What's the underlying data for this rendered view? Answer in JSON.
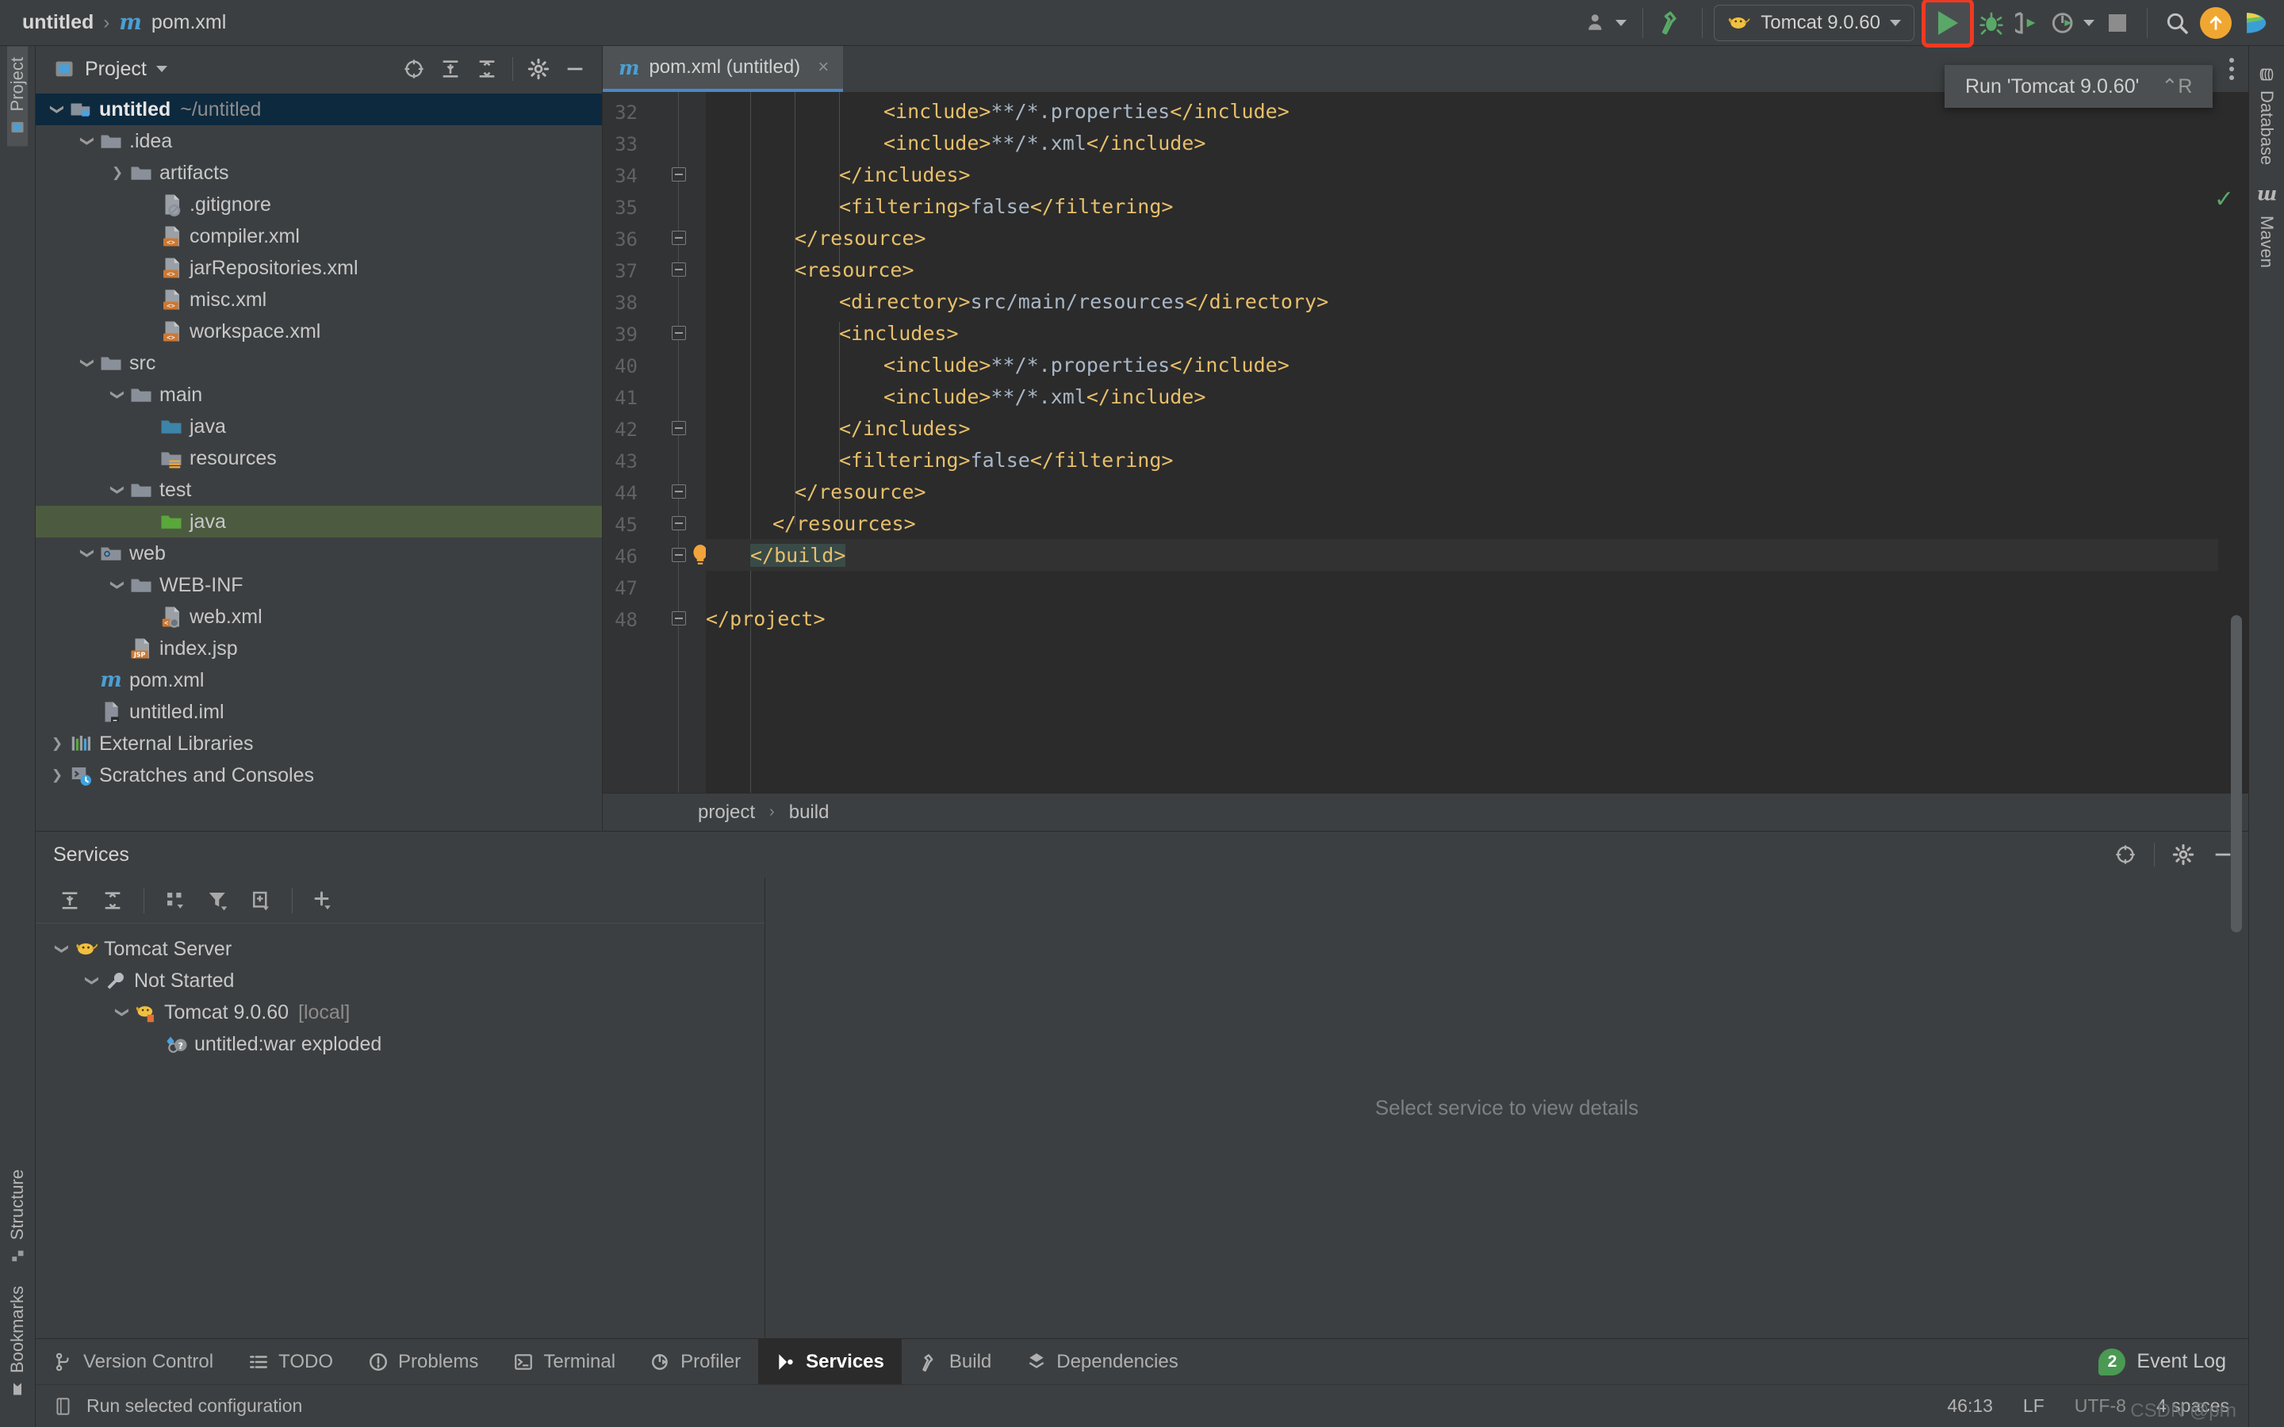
{
  "titlebar": {
    "project_name": "untitled",
    "separator": "›",
    "file_icon": "maven-icon",
    "file_name": "pom.xml",
    "account_icon": "account-icon",
    "build_icon": "build-hammer-icon",
    "run_config_icon": "tomcat-icon",
    "run_config_label": "Tomcat 9.0.60",
    "run_icon": "run-icon",
    "debug_icon": "debug-icon",
    "run_coverage_icon": "run-with-coverage-icon",
    "profiler_icon": "profiler-icon",
    "stop_icon": "stop-icon",
    "search_icon": "search-everywhere-icon",
    "update_icon": "update-project-icon",
    "ide_icon": "ide-feature-icon"
  },
  "tooltip": {
    "label": "Run 'Tomcat 9.0.60'",
    "shortcut": "⌃R"
  },
  "left_stripe": {
    "items": [
      {
        "label": "Project",
        "icon": "project-folder-icon",
        "active": true
      },
      {
        "label": "Structure",
        "icon": "structure-icon",
        "active": false
      },
      {
        "label": "Bookmarks",
        "icon": "bookmark-icon",
        "active": false
      }
    ]
  },
  "right_stripe": {
    "items": [
      {
        "label": "Database",
        "icon": "database-icon"
      },
      {
        "label": "Maven",
        "icon": "maven-icon"
      }
    ]
  },
  "project_panel": {
    "title": "Project",
    "caret": "▾",
    "icons": [
      "locate-icon",
      "expand-all-icon",
      "collapse-all-icon",
      "settings-gear-icon",
      "hide-icon"
    ],
    "tree": [
      {
        "depth": 0,
        "arrow": "down",
        "icon": "module-icon",
        "label": "untitled",
        "suffix": "~/untitled",
        "bold": true,
        "state": "selected-blue"
      },
      {
        "depth": 1,
        "arrow": "down",
        "icon": "folder-icon",
        "label": ".idea",
        "suffix": "",
        "bold": false,
        "state": ""
      },
      {
        "depth": 2,
        "arrow": "right",
        "icon": "folder-icon",
        "label": "artifacts",
        "suffix": "",
        "bold": false,
        "state": ""
      },
      {
        "depth": 3,
        "arrow": "none",
        "icon": "gitignore-file-icon",
        "label": ".gitignore",
        "suffix": "",
        "bold": false,
        "state": ""
      },
      {
        "depth": 3,
        "arrow": "none",
        "icon": "xml-file-icon",
        "label": "compiler.xml",
        "suffix": "",
        "bold": false,
        "state": ""
      },
      {
        "depth": 3,
        "arrow": "none",
        "icon": "xml-file-icon",
        "label": "jarRepositories.xml",
        "suffix": "",
        "bold": false,
        "state": ""
      },
      {
        "depth": 3,
        "arrow": "none",
        "icon": "xml-file-icon",
        "label": "misc.xml",
        "suffix": "",
        "bold": false,
        "state": ""
      },
      {
        "depth": 3,
        "arrow": "none",
        "icon": "xml-file-icon",
        "label": "workspace.xml",
        "suffix": "",
        "bold": false,
        "state": ""
      },
      {
        "depth": 1,
        "arrow": "down",
        "icon": "folder-icon",
        "label": "src",
        "suffix": "",
        "bold": false,
        "state": ""
      },
      {
        "depth": 2,
        "arrow": "down",
        "icon": "folder-icon",
        "label": "main",
        "suffix": "",
        "bold": false,
        "state": ""
      },
      {
        "depth": 3,
        "arrow": "none",
        "icon": "source-root-icon",
        "label": "java",
        "suffix": "",
        "bold": false,
        "state": ""
      },
      {
        "depth": 3,
        "arrow": "none",
        "icon": "resource-root-icon",
        "label": "resources",
        "suffix": "",
        "bold": false,
        "state": ""
      },
      {
        "depth": 2,
        "arrow": "down",
        "icon": "folder-icon",
        "label": "test",
        "suffix": "",
        "bold": false,
        "state": ""
      },
      {
        "depth": 3,
        "arrow": "none",
        "icon": "test-root-icon",
        "label": "java",
        "suffix": "",
        "bold": false,
        "state": "selected-green"
      },
      {
        "depth": 1,
        "arrow": "down",
        "icon": "web-folder-icon",
        "label": "web",
        "suffix": "",
        "bold": false,
        "state": ""
      },
      {
        "depth": 2,
        "arrow": "down",
        "icon": "folder-icon",
        "label": "WEB-INF",
        "suffix": "",
        "bold": false,
        "state": ""
      },
      {
        "depth": 3,
        "arrow": "none",
        "icon": "web-xml-file-icon",
        "label": "web.xml",
        "suffix": "",
        "bold": false,
        "state": ""
      },
      {
        "depth": 2,
        "arrow": "none",
        "icon": "jsp-file-icon",
        "label": "index.jsp",
        "suffix": "",
        "bold": false,
        "state": ""
      },
      {
        "depth": 1,
        "arrow": "none",
        "icon": "maven-icon",
        "label": "pom.xml",
        "suffix": "",
        "bold": false,
        "state": ""
      },
      {
        "depth": 1,
        "arrow": "none",
        "icon": "iml-file-icon",
        "label": "untitled.iml",
        "suffix": "",
        "bold": false,
        "state": ""
      },
      {
        "depth": 0,
        "arrow": "right",
        "icon": "libraries-icon",
        "label": "External Libraries",
        "suffix": "",
        "bold": false,
        "state": ""
      },
      {
        "depth": 0,
        "arrow": "right",
        "icon": "scratches-icon",
        "label": "Scratches and Consoles",
        "suffix": "",
        "bold": false,
        "state": ""
      }
    ]
  },
  "editor": {
    "tab": {
      "icon": "maven-icon",
      "label": "pom.xml (untitled)",
      "close": "×"
    },
    "options_icon": "editor-options-icon",
    "first_line": 32,
    "lines": [
      {
        "n": 32,
        "indent": 16,
        "fold": false,
        "bulb": false,
        "parts": [
          {
            "t": "tag",
            "v": "<include>"
          },
          {
            "t": "txt",
            "v": "**/*.properties"
          },
          {
            "t": "tag",
            "v": "</include>"
          }
        ]
      },
      {
        "n": 33,
        "indent": 16,
        "fold": false,
        "bulb": false,
        "parts": [
          {
            "t": "tag",
            "v": "<include>"
          },
          {
            "t": "txt",
            "v": "**/*.xml"
          },
          {
            "t": "tag",
            "v": "</include>"
          }
        ]
      },
      {
        "n": 34,
        "indent": 12,
        "fold": true,
        "bulb": false,
        "parts": [
          {
            "t": "tag",
            "v": "</includes>"
          }
        ]
      },
      {
        "n": 35,
        "indent": 12,
        "fold": false,
        "bulb": false,
        "parts": [
          {
            "t": "tag",
            "v": "<filtering>"
          },
          {
            "t": "txt",
            "v": "false"
          },
          {
            "t": "tag",
            "v": "</filtering>"
          }
        ]
      },
      {
        "n": 36,
        "indent": 8,
        "fold": true,
        "bulb": false,
        "parts": [
          {
            "t": "tag",
            "v": "</resource>"
          }
        ]
      },
      {
        "n": 37,
        "indent": 8,
        "fold": true,
        "bulb": false,
        "parts": [
          {
            "t": "tag",
            "v": "<resource>"
          }
        ]
      },
      {
        "n": 38,
        "indent": 12,
        "fold": false,
        "bulb": false,
        "parts": [
          {
            "t": "tag",
            "v": "<directory>"
          },
          {
            "t": "txt",
            "v": "src/main/resources"
          },
          {
            "t": "tag",
            "v": "</directory>"
          }
        ]
      },
      {
        "n": 39,
        "indent": 12,
        "fold": true,
        "bulb": false,
        "parts": [
          {
            "t": "tag",
            "v": "<includes>"
          }
        ]
      },
      {
        "n": 40,
        "indent": 16,
        "fold": false,
        "bulb": false,
        "parts": [
          {
            "t": "tag",
            "v": "<include>"
          },
          {
            "t": "txt",
            "v": "**/*.properties"
          },
          {
            "t": "tag",
            "v": "</include>"
          }
        ]
      },
      {
        "n": 41,
        "indent": 16,
        "fold": false,
        "bulb": false,
        "parts": [
          {
            "t": "tag",
            "v": "<include>"
          },
          {
            "t": "txt",
            "v": "**/*.xml"
          },
          {
            "t": "tag",
            "v": "</include>"
          }
        ]
      },
      {
        "n": 42,
        "indent": 12,
        "fold": true,
        "bulb": false,
        "parts": [
          {
            "t": "tag",
            "v": "</includes>"
          }
        ]
      },
      {
        "n": 43,
        "indent": 12,
        "fold": false,
        "bulb": false,
        "parts": [
          {
            "t": "tag",
            "v": "<filtering>"
          },
          {
            "t": "txt",
            "v": "false"
          },
          {
            "t": "tag",
            "v": "</filtering>"
          }
        ]
      },
      {
        "n": 44,
        "indent": 8,
        "fold": true,
        "bulb": false,
        "parts": [
          {
            "t": "tag",
            "v": "</resource>"
          }
        ]
      },
      {
        "n": 45,
        "indent": 6,
        "fold": true,
        "bulb": false,
        "parts": [
          {
            "t": "tag",
            "v": "</resources>"
          }
        ]
      },
      {
        "n": 46,
        "indent": 4,
        "fold": true,
        "bulb": true,
        "current": true,
        "highlight": true,
        "parts": [
          {
            "t": "tag",
            "v": "</build>"
          }
        ]
      },
      {
        "n": 47,
        "indent": 0,
        "fold": false,
        "bulb": false,
        "parts": []
      },
      {
        "n": 48,
        "indent": 0,
        "fold": true,
        "bulb": false,
        "parts": [
          {
            "t": "tag",
            "v": "</project>"
          }
        ]
      }
    ],
    "breadcrumbs": [
      "project",
      "build"
    ],
    "breadcrumb_sep": "›"
  },
  "services": {
    "title": "Services",
    "header_icons": [
      "locate-icon",
      "settings-gear-icon",
      "hide-icon"
    ],
    "toolbar_icons": [
      "expand-all-icon",
      "collapse-all-icon",
      "group-by-icon",
      "filter-icon",
      "view-options-icon",
      "add-service-icon"
    ],
    "tree": [
      {
        "depth": 0,
        "arrow": "down",
        "icon": "tomcat-icon",
        "label": "Tomcat Server",
        "suffix": ""
      },
      {
        "depth": 1,
        "arrow": "down",
        "icon": "wrench-icon",
        "label": "Not Started",
        "suffix": ""
      },
      {
        "depth": 2,
        "arrow": "down",
        "icon": "tomcat-run-icon",
        "label": "Tomcat 9.0.60",
        "suffix": "[local]"
      },
      {
        "depth": 3,
        "arrow": "none",
        "icon": "artifact-unknown-icon",
        "label": "untitled:war exploded",
        "suffix": ""
      }
    ],
    "empty_message": "Select service to view details"
  },
  "toolwindow_bar": {
    "items": [
      {
        "label": "Version Control",
        "icon": "vcs-branch-icon",
        "active": false
      },
      {
        "label": "TODO",
        "icon": "todo-icon",
        "active": false
      },
      {
        "label": "Problems",
        "icon": "problems-icon",
        "active": false
      },
      {
        "label": "Terminal",
        "icon": "terminal-icon",
        "active": false
      },
      {
        "label": "Profiler",
        "icon": "profiler-icon",
        "active": false
      },
      {
        "label": "Services",
        "icon": "services-icon",
        "active": true
      },
      {
        "label": "Build",
        "icon": "build-icon",
        "active": false
      },
      {
        "label": "Dependencies",
        "icon": "dependencies-icon",
        "active": false
      }
    ],
    "event_log_count": "2",
    "event_log_label": "Event Log"
  },
  "statusbar": {
    "hint_icon": "status-hint-icon",
    "hint": "Run selected configuration",
    "caret_position": "46:13",
    "line_separator": "LF",
    "encoding": "UTF-8",
    "indent": "4 spaces",
    "watermark": "CSDN @prn"
  }
}
